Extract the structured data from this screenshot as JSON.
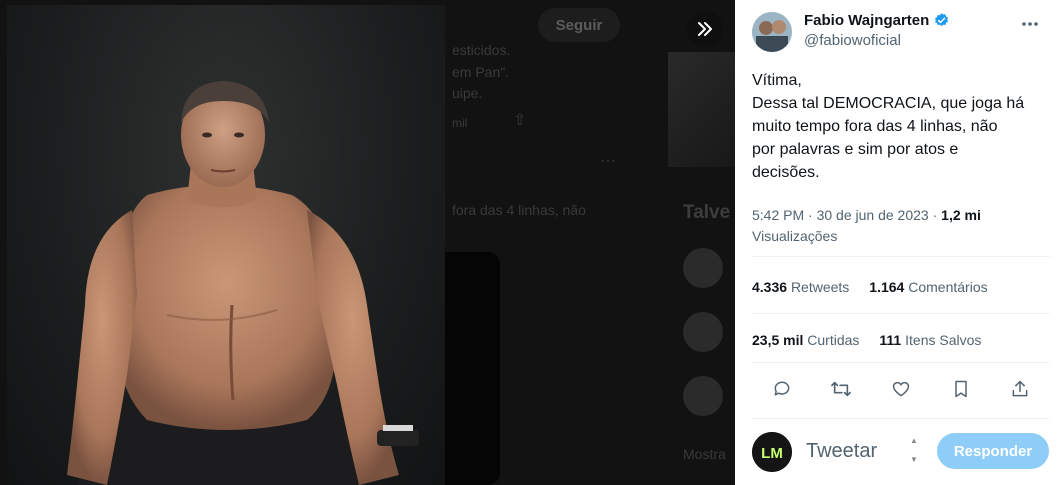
{
  "background": {
    "follow_label": "Seguir",
    "snippets": [
      "esticidos.",
      "em Pan\".",
      "uipe.",
      "mil",
      "fora das 4 linhas, não",
      "Talve",
      "Mostra"
    ]
  },
  "tweet": {
    "author_name": "Fabio Wajngarten",
    "author_handle": "@fabiowoficial",
    "verified": true,
    "text_lines": [
      "Vítima,",
      "Dessa tal DEMOCRACIA, que joga há",
      "muito tempo fora das 4 linhas, não",
      "por palavras e sim por atos e",
      "decisões."
    ],
    "time": "5:42 PM",
    "separator": "·",
    "date": "30 de jun de 2023",
    "views_count": "1,2 mi",
    "views_label": "Visualizações",
    "retweets_count": "4.336",
    "retweets_label": "Retweets",
    "comments_count": "1.164",
    "comments_label": "Comentários",
    "likes_count": "23,5 mil",
    "likes_label": "Curtidas",
    "saves_count": "111",
    "saves_label": "Itens Salvos"
  },
  "reply": {
    "placeholder": "Tweetar",
    "button_label": "Responder",
    "avatar_text": "LM"
  },
  "colors": {
    "accent": "#1d9bf0",
    "reply_button_disabled": "#8ecdf7",
    "secondary_text": "#536471",
    "verified_badge": "#1d9bf0"
  },
  "icons": [
    "expand-icon",
    "verified-badge-icon",
    "more-icon",
    "reply-icon",
    "retweet-icon",
    "like-icon",
    "bookmark-icon",
    "share-icon"
  ]
}
